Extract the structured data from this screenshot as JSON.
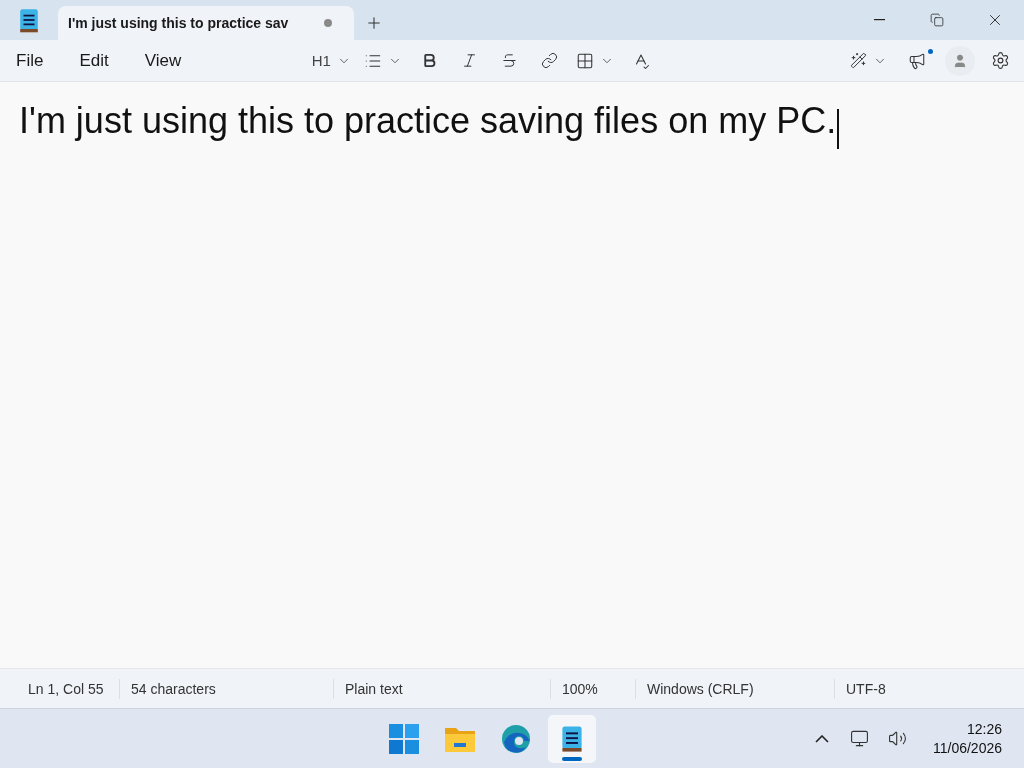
{
  "window": {
    "tab": {
      "title": "I'm just using this to practice sav",
      "unsaved": true
    }
  },
  "menu": [
    "File",
    "Edit",
    "View"
  ],
  "toolbar": {
    "heading": "H1"
  },
  "feedback": {
    "notification": true
  },
  "document": {
    "text": "I'm just using this to practice saving files on my PC."
  },
  "status_bar": [
    "Ln 1, Col 55",
    "54 characters",
    "Plain text",
    "100%",
    "Windows (CRLF)",
    "UTF-8"
  ],
  "taskbar": {
    "apps": [
      {
        "kind": "start",
        "selected": false
      },
      {
        "kind": "explorer",
        "selected": false
      },
      {
        "kind": "edge",
        "selected": false
      },
      {
        "kind": "notepad",
        "selected": true
      }
    ],
    "time": "12:26",
    "date": "11/06/2026"
  }
}
